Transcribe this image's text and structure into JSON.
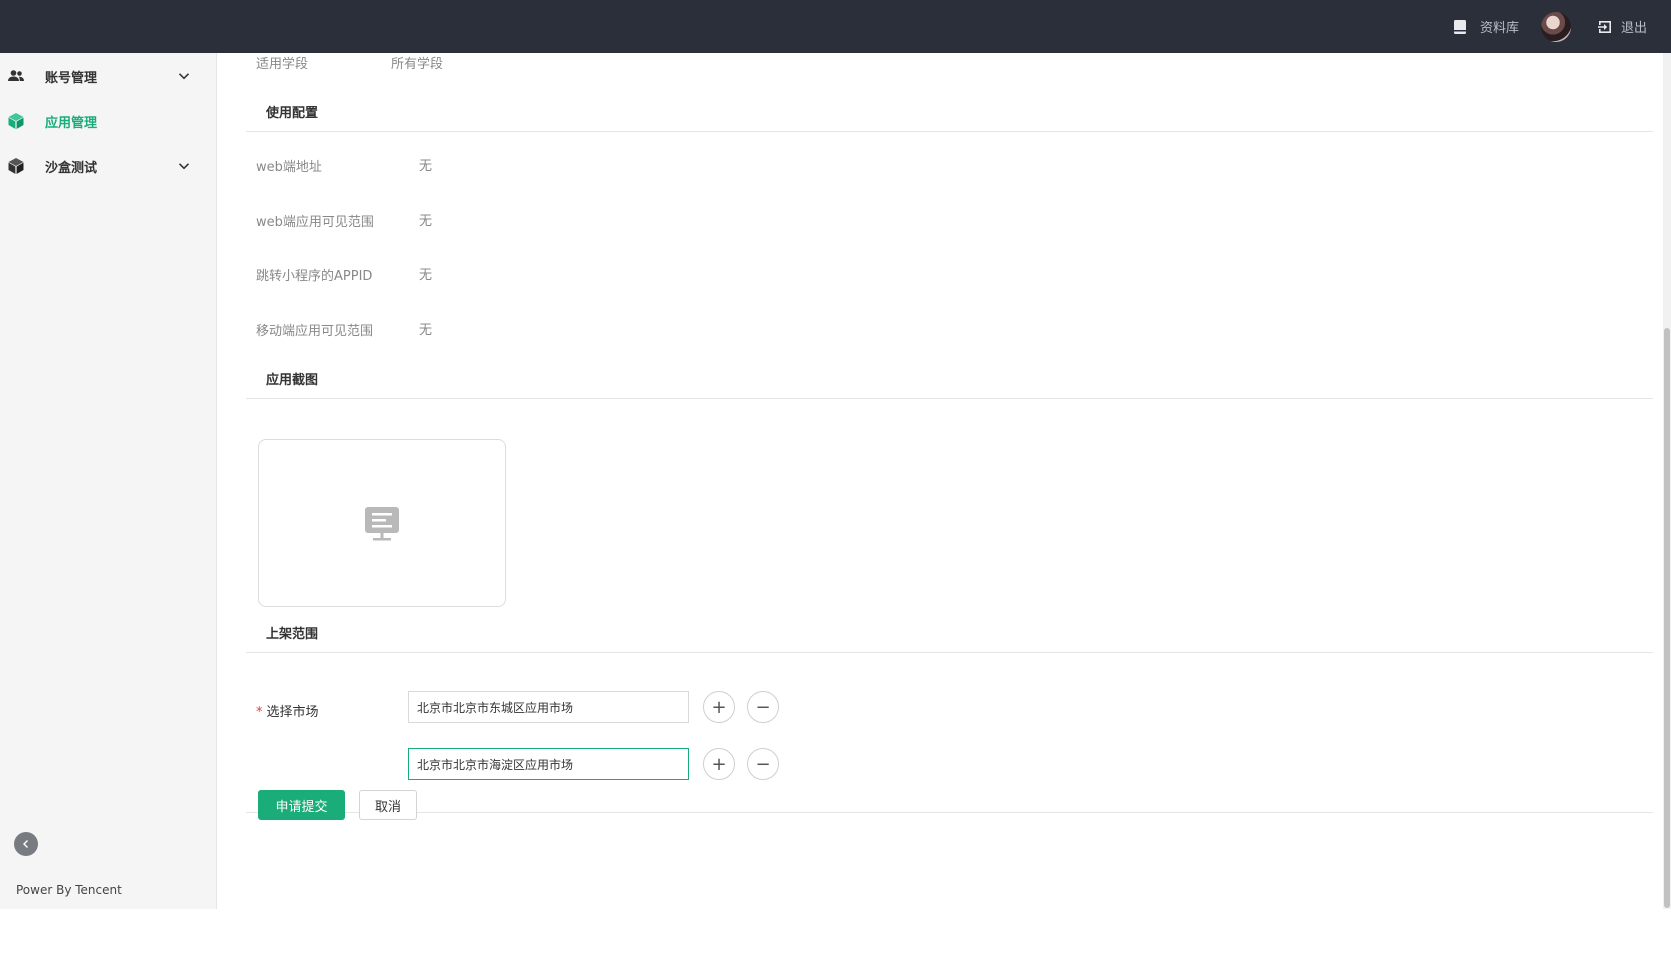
{
  "header": {
    "library_label": "资料库",
    "logout_label": "退出"
  },
  "sidebar": {
    "items": [
      {
        "label": "账号管理",
        "icon": "users-icon",
        "expandable": true,
        "active": false
      },
      {
        "label": "应用管理",
        "icon": "cube-icon",
        "expandable": false,
        "active": true
      },
      {
        "label": "沙盒测试",
        "icon": "box-icon",
        "expandable": true,
        "active": false
      }
    ],
    "footer": "Power By Tencent",
    "accent_color": "#1aad7a"
  },
  "main": {
    "applicable_stage": {
      "label": "适用学段",
      "value": "所有学段"
    },
    "usage_config": {
      "title": "使用配置",
      "rows": [
        {
          "label": "web端地址",
          "value": "无"
        },
        {
          "label": "web端应用可见范围",
          "value": "无"
        },
        {
          "label": "跳转小程序的APPID",
          "value": "无"
        },
        {
          "label": "移动端应用可见范围",
          "value": "无"
        }
      ]
    },
    "screenshots": {
      "title": "应用截图",
      "placeholder_icon": "image-placeholder-icon"
    },
    "listing_scope": {
      "title": "上架范围",
      "required_mark": "*",
      "field_label": "选择市场",
      "markets": [
        "北京市北京市东城区应用市场",
        "北京市北京市海淀区应用市场"
      ],
      "add_symbol": "+",
      "remove_symbol": "−"
    },
    "actions": {
      "submit_label": "申请提交",
      "cancel_label": "取消"
    }
  }
}
